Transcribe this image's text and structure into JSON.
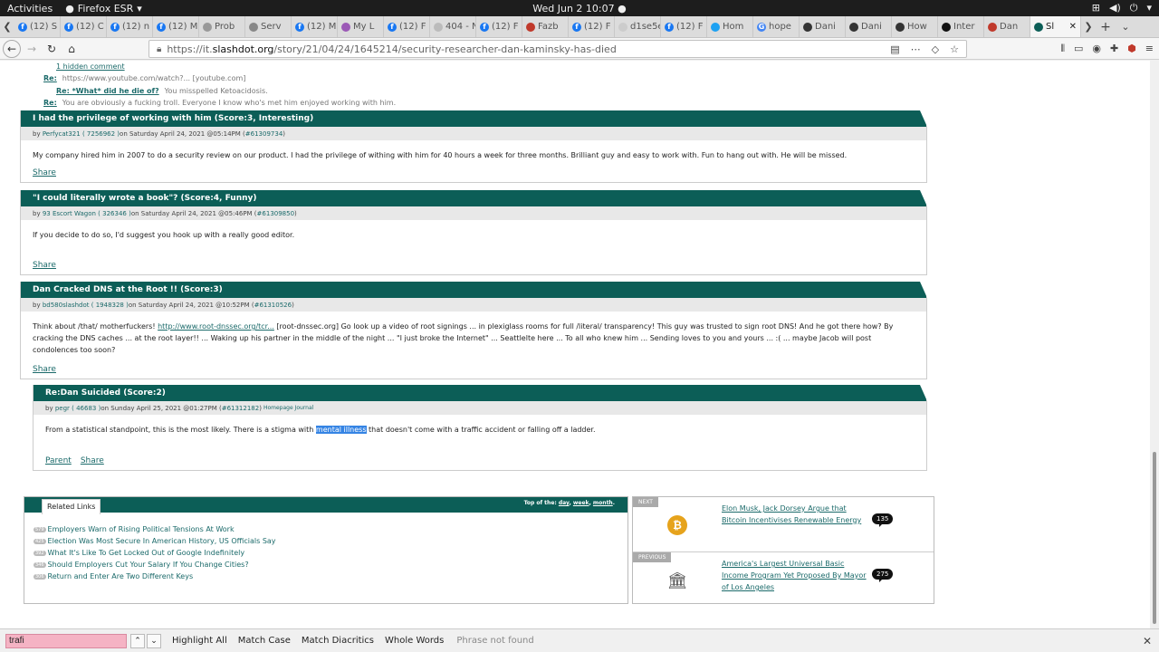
{
  "gnome": {
    "activities": "Activities",
    "app_name": "Firefox ESR",
    "clock": "Wed Jun 2  10:07 ●"
  },
  "tabs": [
    {
      "label": "(12) S",
      "fav": "f",
      "color": "#1877f2"
    },
    {
      "label": "(12) C",
      "fav": "f",
      "color": "#1877f2"
    },
    {
      "label": "(12) n",
      "fav": "f",
      "color": "#1877f2"
    },
    {
      "label": "(12) M",
      "fav": "f",
      "color": "#1877f2"
    },
    {
      "label": "Prob",
      "fav": "",
      "color": "#999"
    },
    {
      "label": "Serv",
      "fav": "",
      "color": "#888"
    },
    {
      "label": "(12) M",
      "fav": "f",
      "color": "#1877f2"
    },
    {
      "label": "My L",
      "fav": "",
      "color": "#9b59b6"
    },
    {
      "label": "(12) F",
      "fav": "f",
      "color": "#1877f2"
    },
    {
      "label": "404 - N",
      "fav": "",
      "color": "#bbb"
    },
    {
      "label": "(12) F",
      "fav": "f",
      "color": "#1877f2"
    },
    {
      "label": "Fazb",
      "fav": "",
      "color": "#c0392b"
    },
    {
      "label": "(12) F",
      "fav": "f",
      "color": "#1877f2"
    },
    {
      "label": "d1se5en",
      "fav": "",
      "color": "#ccc"
    },
    {
      "label": "(12) F",
      "fav": "f",
      "color": "#1877f2"
    },
    {
      "label": "Hom",
      "fav": "",
      "color": "#1da1f2"
    },
    {
      "label": "hope",
      "fav": "G",
      "color": "#4285f4"
    },
    {
      "label": "Dani",
      "fav": "",
      "color": "#333"
    },
    {
      "label": "Dani",
      "fav": "",
      "color": "#333"
    },
    {
      "label": "How",
      "fav": "",
      "color": "#333"
    },
    {
      "label": "Inter",
      "fav": "",
      "color": "#111"
    },
    {
      "label": "Dan",
      "fav": "",
      "color": "#c0392b"
    },
    {
      "label": "Sl",
      "fav": "",
      "color": "#0c5e57",
      "active": true
    }
  ],
  "nav": {
    "url_prefix": "https://it.",
    "url_domain": "slashdot.org",
    "url_path": "/story/21/04/24/1645214/security-researcher-dan-kaminsky-has-died"
  },
  "thread_lines": {
    "hidden": "1 hidden comment",
    "reply1_label": "Re:",
    "reply1_text": "https://www.youtube.com/watch?... [youtube.com]",
    "reply2_label": "Re: *What* did he die of?",
    "reply2_text": "You misspelled Ketoacidosis.",
    "reply3_label": "Re:",
    "reply3_text": "You are obviously a fucking troll. Everyone I know who's met him enjoyed working with him."
  },
  "comments": [
    {
      "title": "I had the privilege of working with him (Score:3, Interesting)",
      "meta_by": "by ",
      "user": "Perfycat321",
      "uid": "( 7256962 )",
      "date": " on Saturday April 24, 2021 @05:14PM (",
      "cid": "#61309734",
      "close": ")",
      "body": "My company hired him in 2007 to do a security review on our product. I had the privilege of withing with him for 40 hours a week for three months. Brilliant guy and easy to work with. Fun to hang out with. He will be missed.",
      "share": "Share"
    },
    {
      "title": "\"I could literally wrote a book\"? (Score:4, Funny)",
      "meta_by": "by ",
      "user": "93 Escort Wagon",
      "uid": "( 326346 )",
      "date": " on Saturday April 24, 2021 @05:46PM (",
      "cid": "#61309850",
      "close": ")",
      "body": "If you decide to do so, I'd suggest you hook up with a really good editor.",
      "share": "Share"
    },
    {
      "title": "Dan Cracked DNS at the Root !! (Score:3)",
      "meta_by": "by ",
      "user": "bd580slashdot",
      "uid": "( 1948328 )",
      "date": " on Saturday April 24, 2021 @10:52PM (",
      "cid": "#61310526",
      "close": ")",
      "body_pre": "Think about /that/ motherfuckers! ",
      "body_link": "http://www.root-dnssec.org/tcr...",
      "body_post": " [root-dnssec.org] Go look up a video of root signings ... in plexiglass rooms for full /literal/ transparency! This guy was trusted to sign root DNS! And he got there how? By cracking the DNS caches ... at the root layer!! ... Waking up his partner in the middle of the night ... \"I just broke the Internet\" ... Seattlelte here ... To all who knew him ... Sending loves to you and yours ... :( ... maybe Jacob will post condolences too soon?",
      "share": "Share"
    },
    {
      "title": "Re:Dan Suicided (Score:2)",
      "meta_by": "by ",
      "user": "pegr",
      "uid": "( 46683 )",
      "date": " on Sunday April 25, 2021 @01:27PM (",
      "cid": "#61312182",
      "close": ")",
      "extra": "Homepage Journal",
      "body_pre": "From a statistical standpoint, this is the most likely. There is a stigma with ",
      "body_hl": "mental illness",
      "body_post": " that doesn't come with a traffic accident or falling off a ladder.",
      "parent": "Parent",
      "share": "Share"
    }
  ],
  "related": {
    "tab": "Related Links",
    "top_of": "Top of the:",
    "day": "day",
    "week": "week",
    "month": "month",
    "links": [
      {
        "count": "579",
        "text": "Employers Warn of Rising Political Tensions At Work"
      },
      {
        "count": "425",
        "text": "Election Was Most Secure In American History, US Officials Say"
      },
      {
        "count": "392",
        "text": "What It's Like To Get Locked Out of Google Indefinitely"
      },
      {
        "count": "346",
        "text": "Should Employers Cut Your Salary If You Change Cities?"
      },
      {
        "count": "306",
        "text": "Return and Enter Are Two Different Keys"
      }
    ]
  },
  "next": {
    "label": "NEXT",
    "title": "Elon Musk, Jack Dorsey Argue that Bitcoin Incentivises Renewable Energy",
    "count": "135"
  },
  "previous": {
    "label": "PREVIOUS",
    "title": "America's Largest Universal Basic Income Program Yet Proposed By Mayor of Los Angeles",
    "count": "275"
  },
  "findbar": {
    "value": "trafi",
    "highlight_all": "Highlight All",
    "match_case": "Match Case",
    "match_diacritics": "Match Diacritics",
    "whole_words": "Whole Words",
    "status": "Phrase not found"
  },
  "colors": {
    "header_green": "#0c5e57",
    "link": "#1b6a6a",
    "find_not_found": "#f5b3c4"
  }
}
